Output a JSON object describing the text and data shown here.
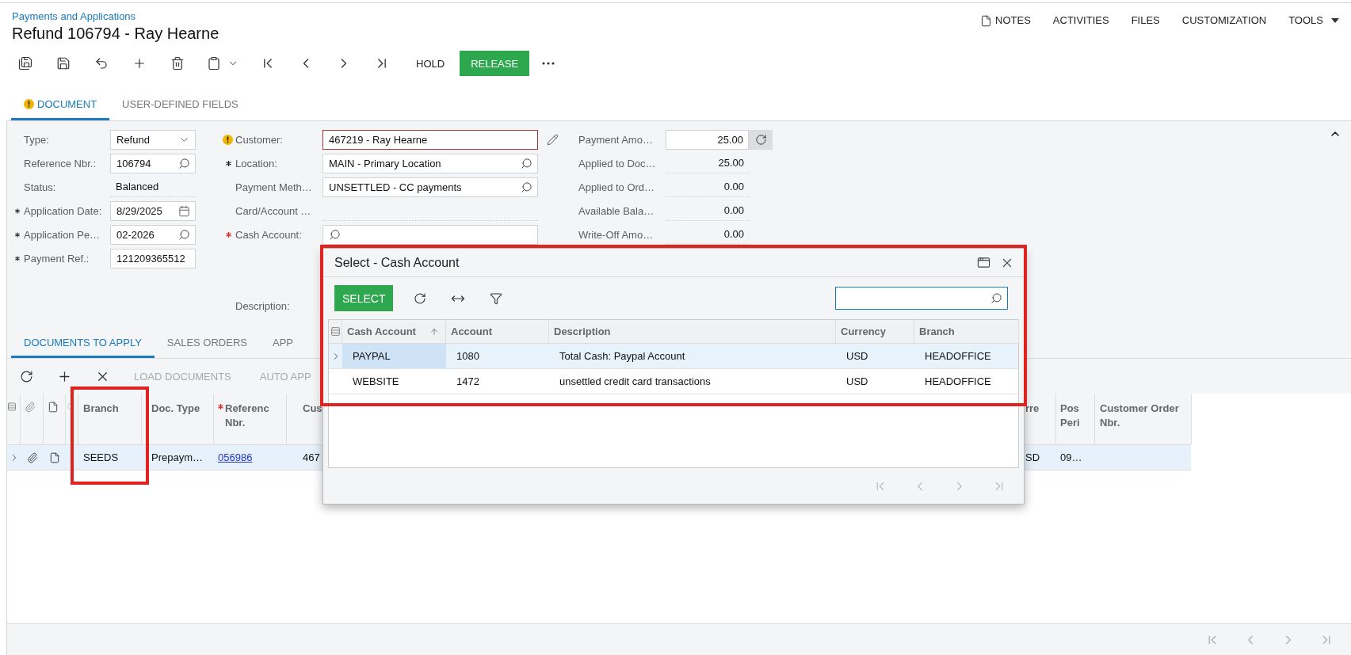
{
  "breadcrumb": "Payments and Applications",
  "title": "Refund 106794 - Ray Hearne",
  "top_links": [
    {
      "label": "NOTES",
      "kind": "notes"
    },
    {
      "label": "ACTIVITIES",
      "kind": "plain"
    },
    {
      "label": "FILES",
      "kind": "plain"
    },
    {
      "label": "CUSTOMIZATION",
      "kind": "plain"
    },
    {
      "label": "TOOLS",
      "kind": "menu"
    }
  ],
  "toolbar": {
    "actions": [
      {
        "label": "HOLD",
        "kind": "plain"
      },
      {
        "label": "RELEASE",
        "kind": "primary"
      }
    ]
  },
  "tabs": [
    {
      "label": "DOCUMENT",
      "selected": true,
      "warning": true
    },
    {
      "label": "USER-DEFINED FIELDS",
      "selected": false
    }
  ],
  "form": {
    "columns": [
      {
        "fields": [
          {
            "label": "Type:",
            "value": "Refund",
            "kind": "select"
          },
          {
            "label": "Reference Nbr.:",
            "value": "106794",
            "kind": "lookup"
          },
          {
            "label": "Status:",
            "value": "Balanced",
            "kind": "readonly"
          },
          {
            "label": "Application Date:",
            "value": "8/29/2025",
            "kind": "date",
            "required": true
          },
          {
            "label": "Application Pe…",
            "value": "02-2026",
            "kind": "lookup",
            "required": true
          },
          {
            "label": "Payment Ref.:",
            "value": "121209365512",
            "kind": "text",
            "required": true
          }
        ]
      },
      {
        "fields": [
          {
            "label": "Customer:",
            "value": "467219 - Ray Hearne",
            "kind": "edit",
            "warning": true,
            "error": true
          },
          {
            "label": "Location:",
            "value": "MAIN - Primary Location",
            "kind": "lookup",
            "required": true
          },
          {
            "label": "Payment Meth…",
            "value": "UNSETTLED - CC payments",
            "kind": "lookup"
          },
          {
            "label": "Card/Account …",
            "kind": "readonly"
          },
          {
            "label": "Cash Account:",
            "kind": "lookup",
            "required": true,
            "missing": true
          },
          {
            "label": "Description:",
            "kind": "note"
          }
        ]
      },
      {
        "fields": [
          {
            "label": "Payment Amo…",
            "value": "25.00",
            "kind": "amount"
          },
          {
            "label": "Applied to Doc…",
            "value": "25.00",
            "kind": "total"
          },
          {
            "label": "Applied to Ord…",
            "value": "0.00",
            "kind": "total"
          },
          {
            "label": "Available Bala…",
            "value": "0.00",
            "kind": "total"
          },
          {
            "label": "Write-Off Amo…",
            "value": "0.00",
            "kind": "total"
          }
        ]
      }
    ]
  },
  "detail_tabs": [
    {
      "label": "DOCUMENTS TO APPLY",
      "selected": true
    },
    {
      "label": "SALES ORDERS",
      "selected": false
    },
    {
      "label": "APP",
      "selected": false
    }
  ],
  "detail_toolbar": [
    {
      "label": "LOAD DOCUMENTS",
      "disabled": true
    },
    {
      "label": "AUTO APP",
      "disabled": true
    }
  ],
  "grid": {
    "columns": [
      {
        "label": "Branch"
      },
      {
        "label": "Doc. Type"
      },
      {
        "label": "Referenc Nbr.",
        "required": true
      },
      {
        "label": "Cus"
      },
      {
        "label": "rre"
      },
      {
        "label": "Pos Peri"
      },
      {
        "label": "Customer Order Nbr."
      }
    ],
    "rows": [
      {
        "selected": true,
        "cells": [
          {
            "text": "SEEDS",
            "kind": "text"
          },
          {
            "text": "Prepaym…",
            "kind": "text"
          },
          {
            "text": "056986",
            "kind": "link"
          },
          {
            "text": "467",
            "kind": "text"
          },
          {
            "text": "SD",
            "kind": "text"
          },
          {
            "text": "09…",
            "kind": "text"
          }
        ]
      }
    ]
  },
  "dialog": {
    "title": "Select - Cash Account",
    "select_label": "SELECT",
    "columns": [
      {
        "label": "Cash Account",
        "sorted": true
      },
      {
        "label": "Account"
      },
      {
        "label": "Description"
      },
      {
        "label": "Currency"
      },
      {
        "label": "Branch"
      }
    ],
    "rows": [
      {
        "selected": true,
        "cells": [
          "PAYPAL",
          "1080",
          "Total Cash: Paypal Account",
          "USD",
          "HEADOFFICE"
        ]
      },
      {
        "selected": false,
        "cells": [
          "WEBSITE",
          "1472",
          "unsettled credit card transactions",
          "USD",
          "HEADOFFICE"
        ]
      }
    ]
  }
}
